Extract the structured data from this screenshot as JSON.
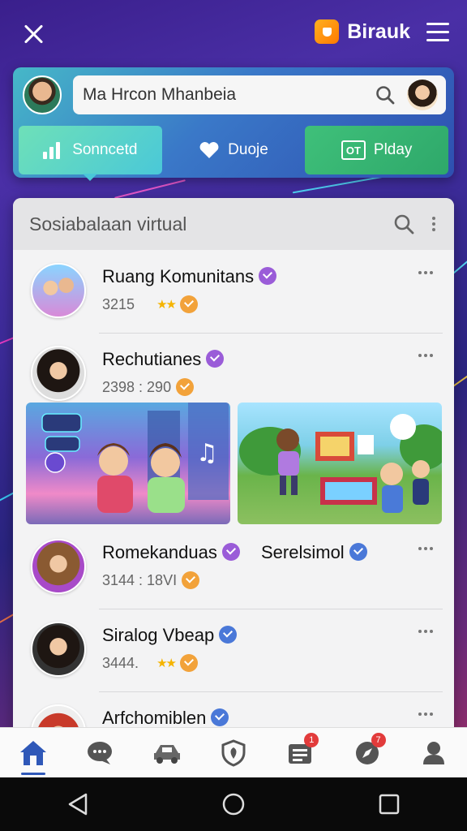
{
  "app": {
    "brand": "Birauk"
  },
  "search": {
    "value": "Ma Hrcon Mhanbeia"
  },
  "tabs": [
    {
      "label": "Sonncetd"
    },
    {
      "label": "Duoje"
    },
    {
      "label": "Plday",
      "icon_text": "OT"
    }
  ],
  "panel": {
    "title": "Sosiabalaan virtual"
  },
  "feed": [
    {
      "name": "Ruang Komunitans",
      "meta": "3215",
      "stars": "★★",
      "verified_color": "#9a5cd8"
    },
    {
      "name": "Rechutianes",
      "meta": "2398 : 290",
      "verified_color": "#9a5cd8"
    },
    {
      "name": "Romekanduas",
      "name2": "Serelsimol",
      "meta": "3144 : 18VI",
      "verified_color": "#9a5cd8"
    },
    {
      "name": "Siralog Vbeap",
      "meta": "3444.",
      "stars": "★★",
      "verified_color": "#4a78d8"
    },
    {
      "name": "Arfchomiblen",
      "verified_color": "#4a78d8"
    }
  ],
  "bottom_nav": {
    "items": [
      {
        "icon": "home-icon"
      },
      {
        "icon": "chat-icon"
      },
      {
        "icon": "car-icon"
      },
      {
        "icon": "shield-icon"
      },
      {
        "icon": "news-icon",
        "badge": "1"
      },
      {
        "icon": "compass-icon",
        "badge": "7"
      },
      {
        "icon": "profile-icon"
      }
    ]
  },
  "colors": {
    "accent": "#2f58b8",
    "teal": "#4ac8d8",
    "green": "#3fc07a",
    "badge": "#e23b3b"
  }
}
